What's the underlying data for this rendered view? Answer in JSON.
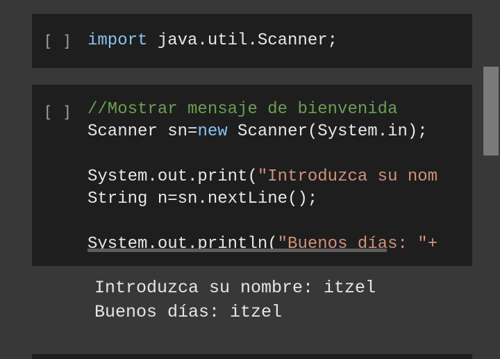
{
  "cells": [
    {
      "run_label": "[ ]",
      "code_lines": [
        [
          {
            "t": "import",
            "c": "kw"
          },
          {
            "t": " java.util.Scanner;",
            "c": ""
          }
        ]
      ]
    },
    {
      "run_label": "[ ]",
      "code_lines": [
        [
          {
            "t": "//Mostrar mensaje de bienvenida",
            "c": "cm"
          }
        ],
        [
          {
            "t": "Scanner sn=",
            "c": ""
          },
          {
            "t": "new",
            "c": "kw"
          },
          {
            "t": " Scanner(System.in);",
            "c": ""
          }
        ],
        [],
        [
          {
            "t": "System.out.print(",
            "c": ""
          },
          {
            "t": "\"Introduzca su nom",
            "c": "st"
          }
        ],
        [
          {
            "t": "String n=sn.nextLine();",
            "c": ""
          }
        ],
        [],
        [
          {
            "t": "System.out.println(",
            "c": ""
          },
          {
            "t": "\"Buenos días: \"+",
            "c": "st"
          }
        ]
      ],
      "output_lines": [
        "Introduzca su nombre: itzel",
        "Buenos días: itzel"
      ]
    }
  ],
  "colors": {
    "background": "#383838",
    "cell_background": "#1e1e1e",
    "keyword": "#86c4f2",
    "comment": "#6a9f52",
    "string": "#d1927a",
    "text": "#e8e8e8"
  }
}
